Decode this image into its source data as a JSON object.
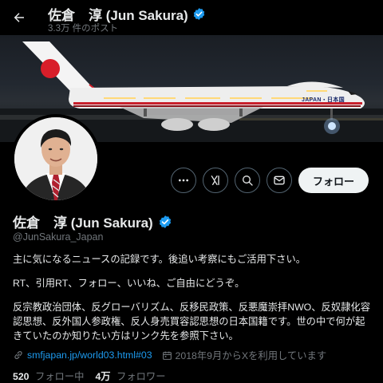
{
  "header": {
    "title": "佐倉　淳 (Jun Sakura)",
    "post_count": "3.3万 件のポスト"
  },
  "banner": {
    "aircraft_text": "JAPAN・日本国"
  },
  "actions": {
    "follow_label": "フォロー"
  },
  "profile": {
    "name": "佐倉　淳 (Jun Sakura)",
    "handle": "@JunSakura_Japan",
    "bio": [
      "主に気になるニュースの記録です。後追い考察にもご活用下さい。",
      "RT、引用RT、フォロー、いいね、ご自由にどうぞ。",
      "反宗教政治団体、反グローバリズム、反移民政策、反悪魔崇拝NWO、反奴隷化容認思想、反外国人参政権、反人身売買容認思想の日本国籍です。世の中で何が起きていたのか知りたい方はリンク先を参照下さい。"
    ],
    "link": "smfjapan.jp/world03.html#03",
    "joined": "2018年9月からXを利用しています"
  },
  "stats": {
    "following_count": "520",
    "following_label": "フォロー中",
    "followers_count": "4万",
    "followers_label": "フォロワー"
  },
  "colors": {
    "accent": "#1d9bf0",
    "background": "#000000",
    "muted_text": "#71767b"
  },
  "icons": [
    "back-arrow-icon",
    "verified-badge-icon",
    "more-icon",
    "grok-icon",
    "search-icon",
    "message-icon",
    "link-icon",
    "calendar-icon"
  ]
}
